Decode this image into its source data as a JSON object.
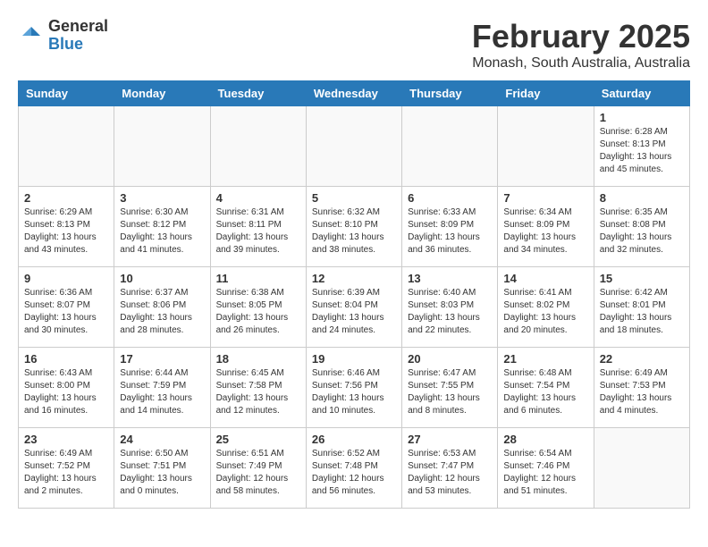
{
  "logo": {
    "general": "General",
    "blue": "Blue"
  },
  "title": "February 2025",
  "subtitle": "Monash, South Australia, Australia",
  "weekdays": [
    "Sunday",
    "Monday",
    "Tuesday",
    "Wednesday",
    "Thursday",
    "Friday",
    "Saturday"
  ],
  "weeks": [
    [
      {
        "day": "",
        "info": ""
      },
      {
        "day": "",
        "info": ""
      },
      {
        "day": "",
        "info": ""
      },
      {
        "day": "",
        "info": ""
      },
      {
        "day": "",
        "info": ""
      },
      {
        "day": "",
        "info": ""
      },
      {
        "day": "1",
        "info": "Sunrise: 6:28 AM\nSunset: 8:13 PM\nDaylight: 13 hours\nand 45 minutes."
      }
    ],
    [
      {
        "day": "2",
        "info": "Sunrise: 6:29 AM\nSunset: 8:13 PM\nDaylight: 13 hours\nand 43 minutes."
      },
      {
        "day": "3",
        "info": "Sunrise: 6:30 AM\nSunset: 8:12 PM\nDaylight: 13 hours\nand 41 minutes."
      },
      {
        "day": "4",
        "info": "Sunrise: 6:31 AM\nSunset: 8:11 PM\nDaylight: 13 hours\nand 39 minutes."
      },
      {
        "day": "5",
        "info": "Sunrise: 6:32 AM\nSunset: 8:10 PM\nDaylight: 13 hours\nand 38 minutes."
      },
      {
        "day": "6",
        "info": "Sunrise: 6:33 AM\nSunset: 8:09 PM\nDaylight: 13 hours\nand 36 minutes."
      },
      {
        "day": "7",
        "info": "Sunrise: 6:34 AM\nSunset: 8:09 PM\nDaylight: 13 hours\nand 34 minutes."
      },
      {
        "day": "8",
        "info": "Sunrise: 6:35 AM\nSunset: 8:08 PM\nDaylight: 13 hours\nand 32 minutes."
      }
    ],
    [
      {
        "day": "9",
        "info": "Sunrise: 6:36 AM\nSunset: 8:07 PM\nDaylight: 13 hours\nand 30 minutes."
      },
      {
        "day": "10",
        "info": "Sunrise: 6:37 AM\nSunset: 8:06 PM\nDaylight: 13 hours\nand 28 minutes."
      },
      {
        "day": "11",
        "info": "Sunrise: 6:38 AM\nSunset: 8:05 PM\nDaylight: 13 hours\nand 26 minutes."
      },
      {
        "day": "12",
        "info": "Sunrise: 6:39 AM\nSunset: 8:04 PM\nDaylight: 13 hours\nand 24 minutes."
      },
      {
        "day": "13",
        "info": "Sunrise: 6:40 AM\nSunset: 8:03 PM\nDaylight: 13 hours\nand 22 minutes."
      },
      {
        "day": "14",
        "info": "Sunrise: 6:41 AM\nSunset: 8:02 PM\nDaylight: 13 hours\nand 20 minutes."
      },
      {
        "day": "15",
        "info": "Sunrise: 6:42 AM\nSunset: 8:01 PM\nDaylight: 13 hours\nand 18 minutes."
      }
    ],
    [
      {
        "day": "16",
        "info": "Sunrise: 6:43 AM\nSunset: 8:00 PM\nDaylight: 13 hours\nand 16 minutes."
      },
      {
        "day": "17",
        "info": "Sunrise: 6:44 AM\nSunset: 7:59 PM\nDaylight: 13 hours\nand 14 minutes."
      },
      {
        "day": "18",
        "info": "Sunrise: 6:45 AM\nSunset: 7:58 PM\nDaylight: 13 hours\nand 12 minutes."
      },
      {
        "day": "19",
        "info": "Sunrise: 6:46 AM\nSunset: 7:56 PM\nDaylight: 13 hours\nand 10 minutes."
      },
      {
        "day": "20",
        "info": "Sunrise: 6:47 AM\nSunset: 7:55 PM\nDaylight: 13 hours\nand 8 minutes."
      },
      {
        "day": "21",
        "info": "Sunrise: 6:48 AM\nSunset: 7:54 PM\nDaylight: 13 hours\nand 6 minutes."
      },
      {
        "day": "22",
        "info": "Sunrise: 6:49 AM\nSunset: 7:53 PM\nDaylight: 13 hours\nand 4 minutes."
      }
    ],
    [
      {
        "day": "23",
        "info": "Sunrise: 6:49 AM\nSunset: 7:52 PM\nDaylight: 13 hours\nand 2 minutes."
      },
      {
        "day": "24",
        "info": "Sunrise: 6:50 AM\nSunset: 7:51 PM\nDaylight: 13 hours\nand 0 minutes."
      },
      {
        "day": "25",
        "info": "Sunrise: 6:51 AM\nSunset: 7:49 PM\nDaylight: 12 hours\nand 58 minutes."
      },
      {
        "day": "26",
        "info": "Sunrise: 6:52 AM\nSunset: 7:48 PM\nDaylight: 12 hours\nand 56 minutes."
      },
      {
        "day": "27",
        "info": "Sunrise: 6:53 AM\nSunset: 7:47 PM\nDaylight: 12 hours\nand 53 minutes."
      },
      {
        "day": "28",
        "info": "Sunrise: 6:54 AM\nSunset: 7:46 PM\nDaylight: 12 hours\nand 51 minutes."
      },
      {
        "day": "",
        "info": ""
      }
    ]
  ]
}
